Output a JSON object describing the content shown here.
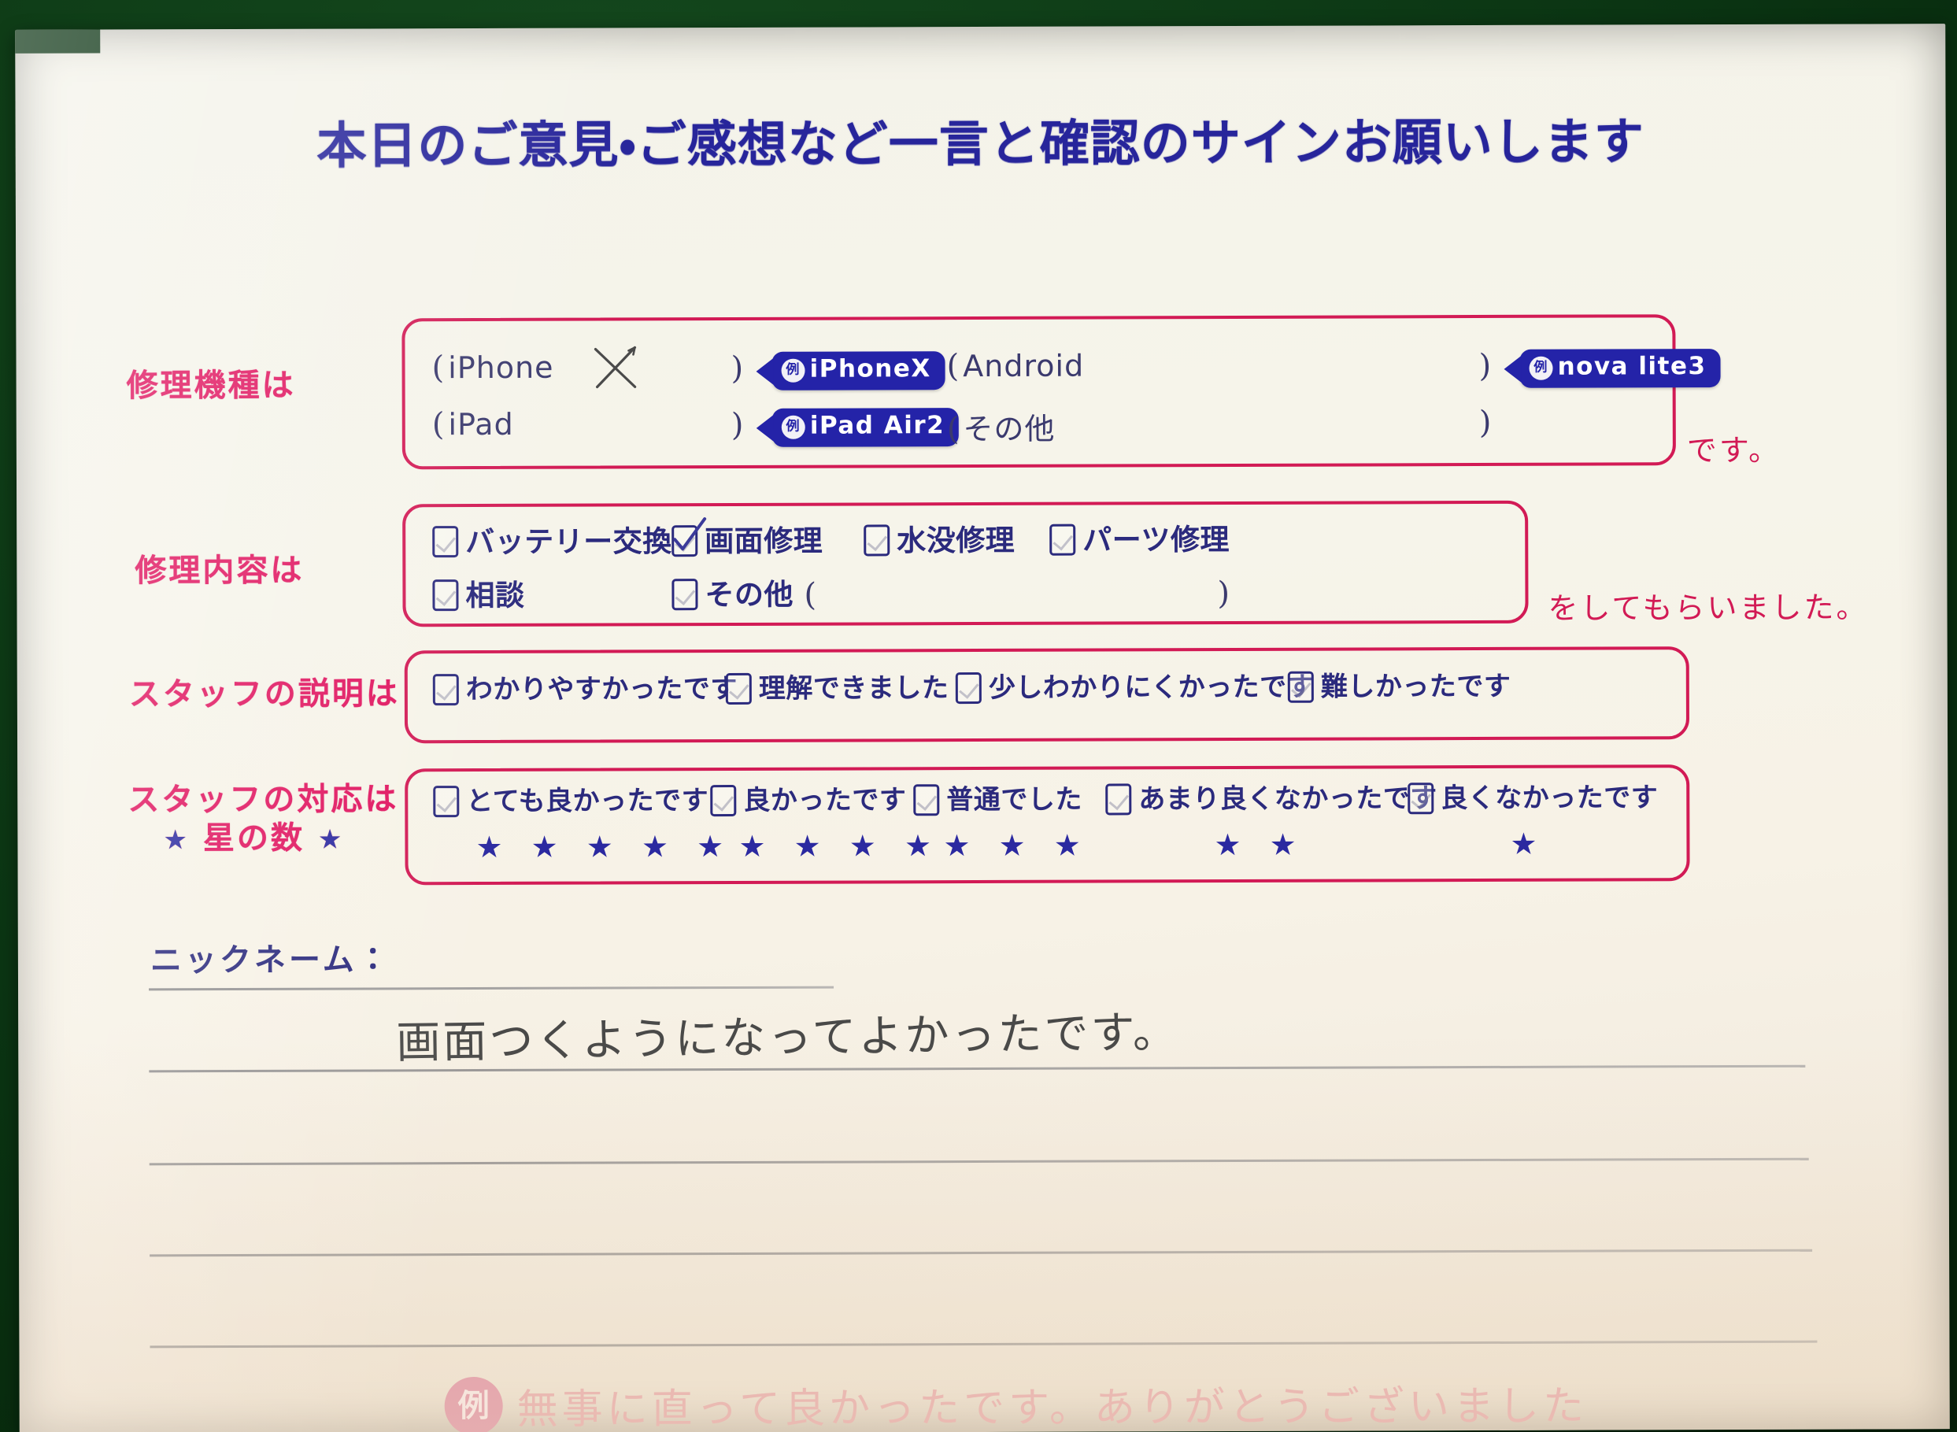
{
  "document": {
    "title": "本日のご意見・ご感想など一言と確認のサインお願いします",
    "paper_color": "#f5f2e8",
    "backdrop_color": "#0c3a16",
    "accent_pink": "#d21a55",
    "accent_blue": "#2b2a7d",
    "badge_blue": "#2423a8"
  },
  "device_section": {
    "label": "修理機種は",
    "suffix": "です。",
    "rows": [
      {
        "left": {
          "open_paren": "(",
          "name": "iPhone",
          "close_paren": ")",
          "marked": "×"
        },
        "left_badge": {
          "chip": "例",
          "text": "iPhoneX"
        },
        "right": {
          "open_paren": "(",
          "name": "Android",
          "close_paren": ")"
        },
        "right_badge": {
          "chip": "例",
          "text": "nova lite3"
        }
      },
      {
        "left": {
          "open_paren": "(",
          "name": "iPad",
          "close_paren": ")"
        },
        "left_badge": {
          "chip": "例",
          "text": "iPad Air2"
        },
        "right": {
          "open_paren": "(",
          "name": "その他",
          "close_paren": ")"
        },
        "right_badge": null
      }
    ]
  },
  "repair_section": {
    "label": "修理内容は",
    "suffix": "をしてもらいました。",
    "options_row1": [
      {
        "label": "バッテリー交換",
        "checked": false
      },
      {
        "label": "画面修理",
        "checked": true
      },
      {
        "label": "水没修理",
        "checked": false
      },
      {
        "label": "パーツ修理",
        "checked": false
      }
    ],
    "options_row2": [
      {
        "label": "相談",
        "checked": false
      },
      {
        "label": "その他",
        "checked": false
      }
    ],
    "other_open_paren": "(",
    "other_close_paren": ")",
    "other_value": ""
  },
  "explanation_section": {
    "label": "スタッフの説明は",
    "options": [
      {
        "label": "わかりやすかったです",
        "checked": false
      },
      {
        "label": "理解できました",
        "checked": false
      },
      {
        "label": "少しわかりにくかったです",
        "checked": false
      },
      {
        "label": "難しかったです",
        "checked": false
      }
    ]
  },
  "response_section": {
    "label_line1": "スタッフの対応は",
    "label_star_left": "★",
    "label_line2": "星の数",
    "label_star_right": "★",
    "options": [
      {
        "label": "とても良かったです",
        "stars": "★ ★ ★ ★ ★",
        "star_count": 5,
        "checked": false
      },
      {
        "label": "良かったです",
        "stars": "★ ★ ★ ★",
        "star_count": 4,
        "checked": false
      },
      {
        "label": "普通でした",
        "stars": "★ ★ ★",
        "star_count": 3,
        "checked": false
      },
      {
        "label": "あまり良くなかったです",
        "stars": "★ ★",
        "star_count": 2,
        "checked": false
      },
      {
        "label": "良くなかったです",
        "stars": "★",
        "star_count": 1,
        "checked": false
      }
    ]
  },
  "comment_section": {
    "nickname_label": "ニックネーム：",
    "nickname_value": "",
    "handwritten_comment": "画面つくようになってよかったです。"
  },
  "footer": {
    "chip": "例",
    "example_text": "無事に直って良かったです。ありがとうございました"
  }
}
